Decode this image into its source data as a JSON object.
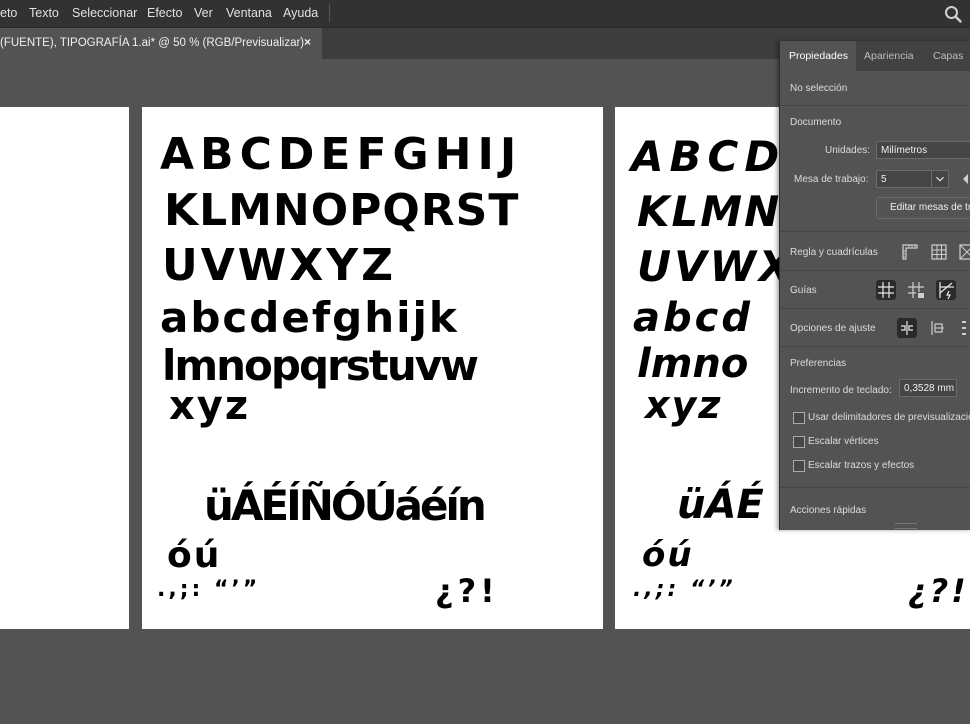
{
  "menubar": {
    "items": [
      "eto",
      "Texto",
      "Seleccionar",
      "Efecto",
      "Ver",
      "Ventana",
      "Ayuda"
    ],
    "search_icon": "search-icon"
  },
  "document_tab": {
    "title": "(FUENTE), TIPOGRAFÍA 1.ai* @ 50 % (RGB/Previsualizar)",
    "close": "×"
  },
  "artboards": {
    "middle": {
      "rows": [
        "ABCDEFGHIJ",
        "KLMNOPQRST",
        "UVWXYZ",
        "abcdefghijk",
        "lmnopqrstuvw",
        "xyz",
        "üÁÉÍÑÓÚáéín",
        "óú",
        ".,;: “’”",
        "¿?!"
      ]
    },
    "right": {
      "rows": [
        "ABCD",
        "KLMN",
        "UVWX",
        "abcd",
        "lmno",
        "xyz",
        "üÁÉ",
        "óú",
        ".,;: “’”",
        "¿?!"
      ]
    }
  },
  "panel": {
    "tabs": [
      "Propiedades",
      "Apariencia",
      "Capas"
    ],
    "no_selection": "No selección",
    "document_section": "Documento",
    "units_label": "Unidades:",
    "units_value": "Milímetros",
    "artboard_label": "Mesa de trabajo:",
    "artboard_value": "5",
    "edit_artboards_button": "Editar mesas de tra",
    "rulers_label": "Regla y cuadrículas",
    "guides_label": "Guías",
    "snap_label": "Opciones de ajuste",
    "preferences_section": "Preferencias",
    "keyboard_increment_label": "Incremento de teclado:",
    "keyboard_increment_value": "0,3528 mm",
    "checkbox_preview_bounds": "Usar delimitadores de previsualizació",
    "checkbox_scale_corners": "Escalar vértices",
    "checkbox_scale_strokes": "Escalar trazos y efectos",
    "quick_actions": "Acciones rápidas"
  },
  "colors": {
    "menubar_bg": "#323232",
    "canvas_bg": "#535353",
    "artboard_bg": "#ffffff",
    "glyph_color": "#000000"
  }
}
